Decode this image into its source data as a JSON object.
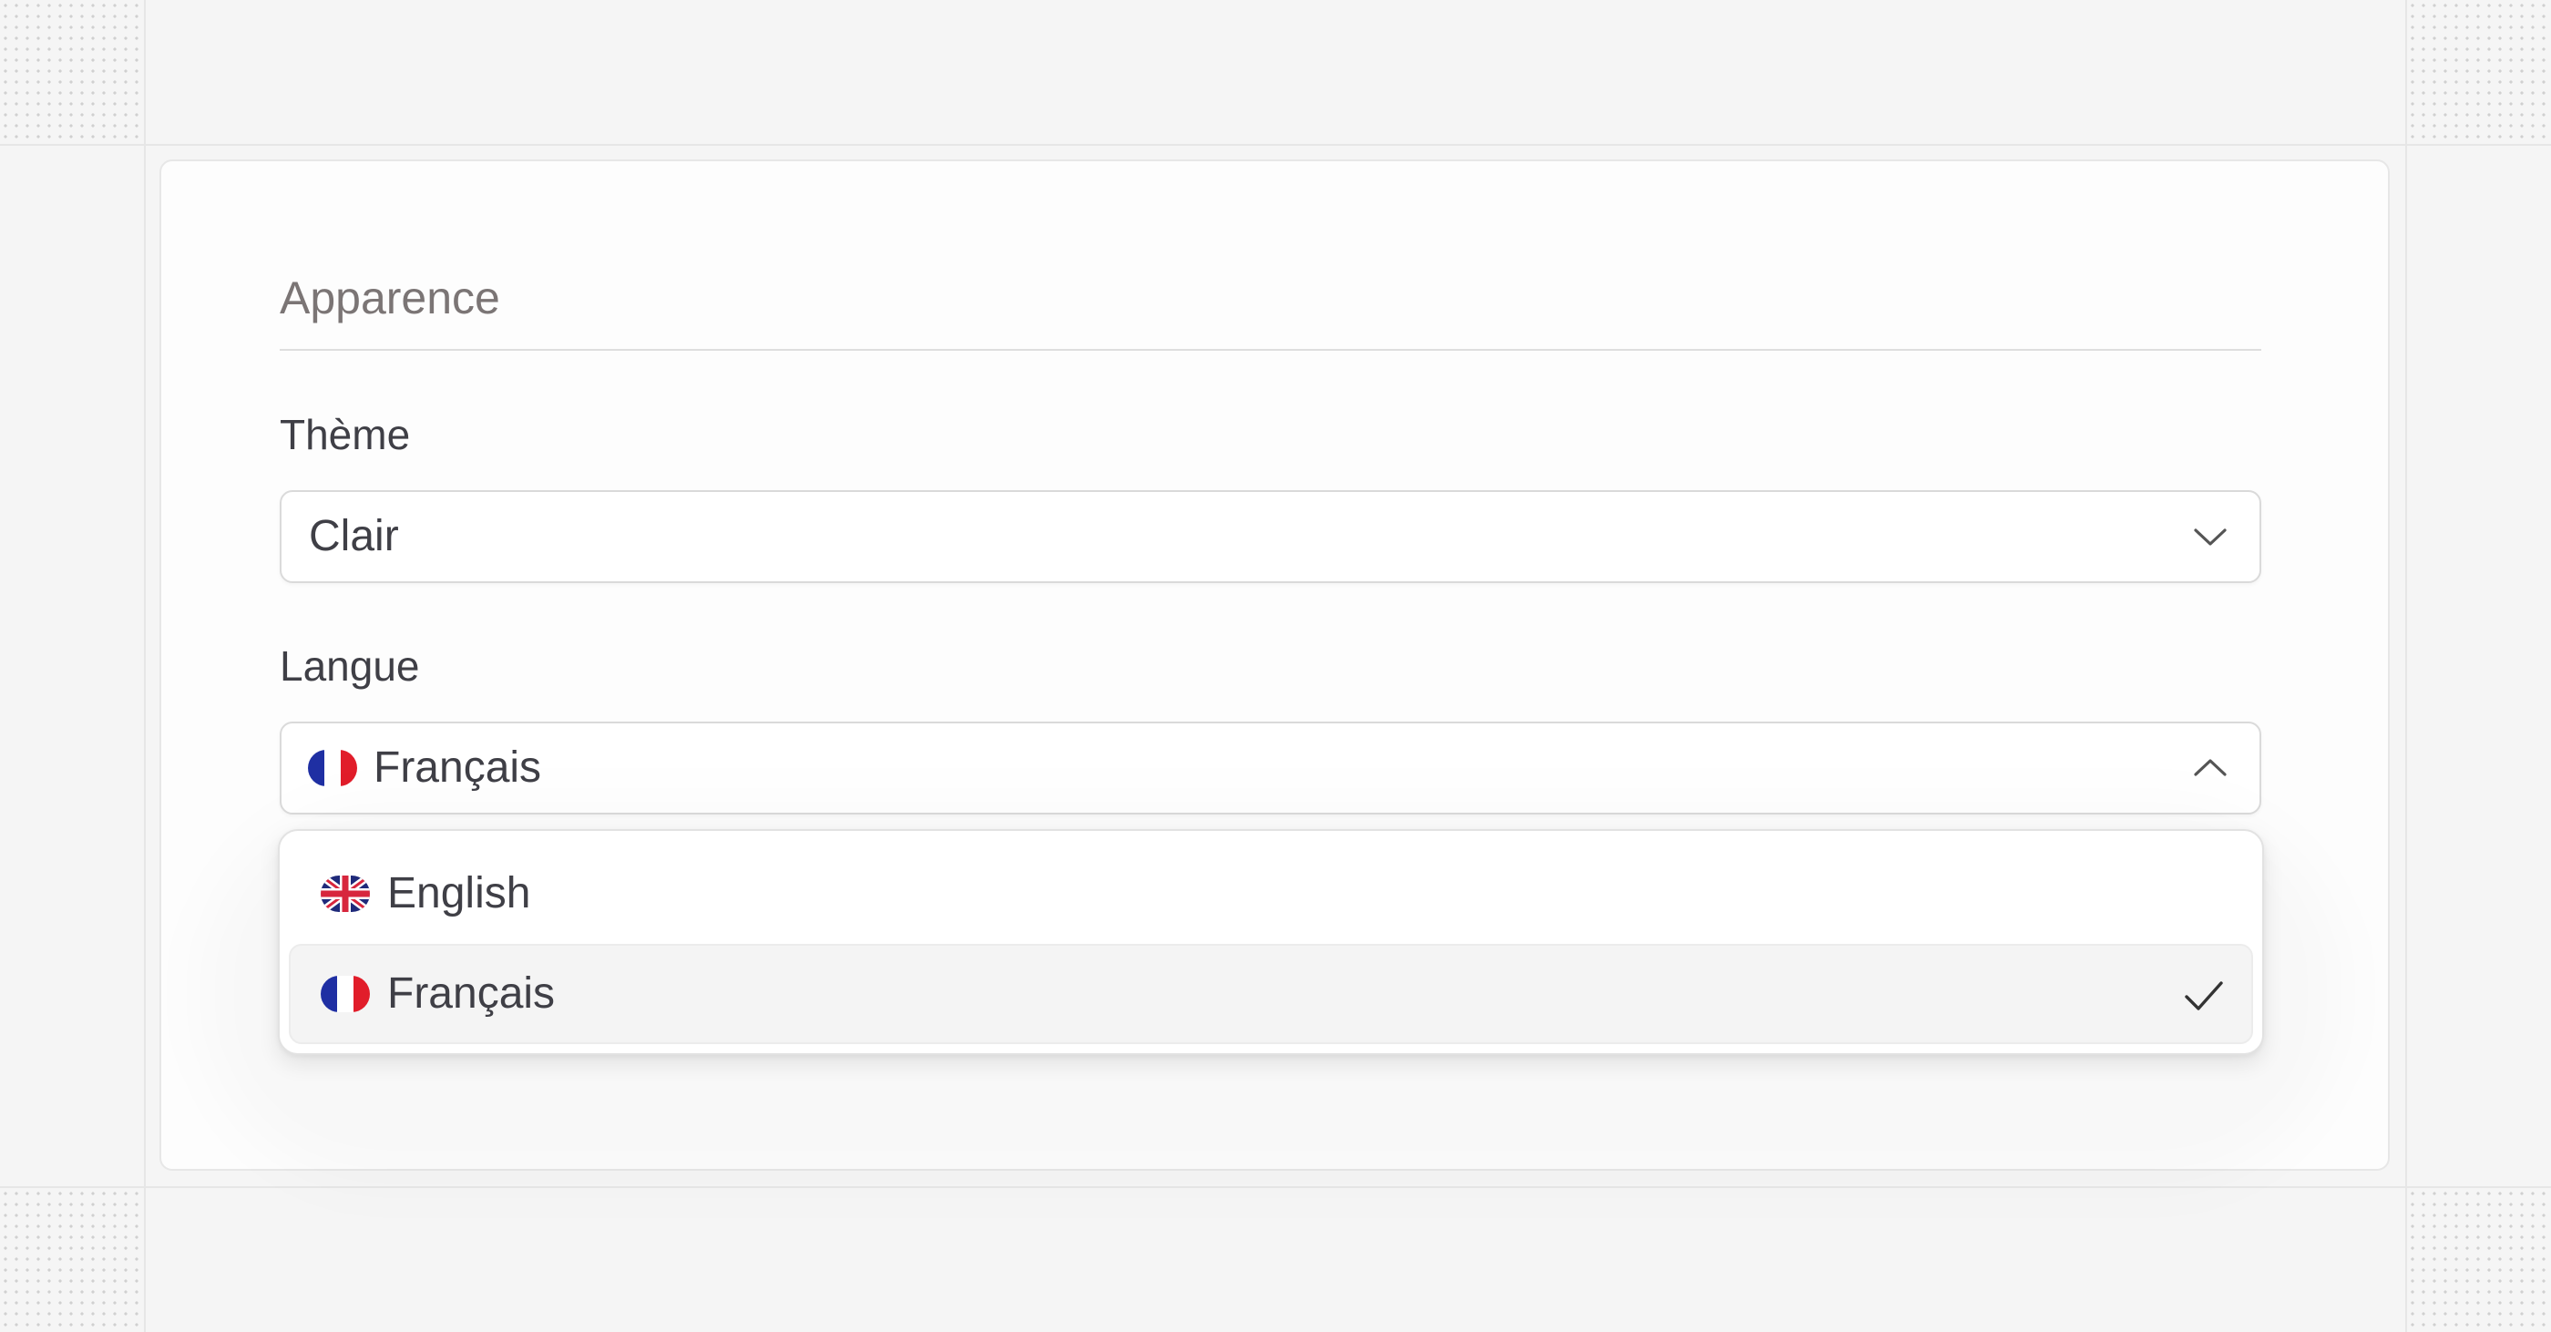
{
  "appearance": {
    "section_title": "Apparence",
    "theme": {
      "label": "Thème",
      "value": "Clair",
      "icon": "chevron-down-icon"
    },
    "language": {
      "label": "Langue",
      "value": "Français",
      "value_flag": "flag-fr-icon",
      "icon": "chevron-up-icon",
      "expanded": true,
      "options": [
        {
          "label": "English",
          "flag": "flag-uk-icon",
          "selected": false
        },
        {
          "label": "Français",
          "flag": "flag-fr-icon",
          "selected": true,
          "indicator": "check-icon"
        }
      ]
    }
  },
  "colors": {
    "page_background": "#f5f5f5",
    "card_background": "#fdfdfd",
    "text": "#3f3f46",
    "section_title": "#7b7575",
    "selected_option_background": "#f4f4f4",
    "french_blue": "#1f2fa3",
    "french_red": "#e11d2a"
  }
}
